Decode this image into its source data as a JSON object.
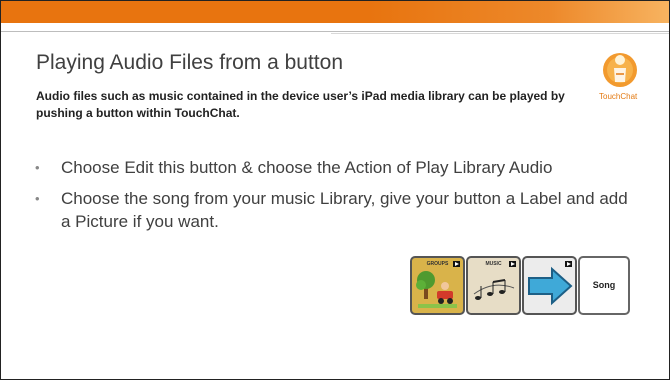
{
  "slide": {
    "title": "Playing Audio Files from a button",
    "subtitle": "Audio files such as music contained in the device user’s iPad media library can be played by pushing a button within TouchChat.",
    "logo": {
      "text": "TouchChat",
      "icon": "touchchat-logo-icon",
      "accent": "#e8740f"
    },
    "bullets": [
      {
        "text": "Choose Edit this button & choose the Action of Play Library Audio"
      },
      {
        "text": "Choose the song from your music Library, give your button a Label and add a Picture if you want."
      }
    ],
    "tiles": [
      {
        "label": "GROUPS",
        "icon": "groups-icon"
      },
      {
        "label": "MUSIC",
        "icon": "music-notes-icon"
      },
      {
        "label": "",
        "icon": "arrow-right-icon"
      },
      {
        "label": "Song",
        "icon": ""
      }
    ]
  },
  "colors": {
    "topbar": "#e8740f",
    "title": "#404040",
    "arrow": "#3fa9d8"
  }
}
